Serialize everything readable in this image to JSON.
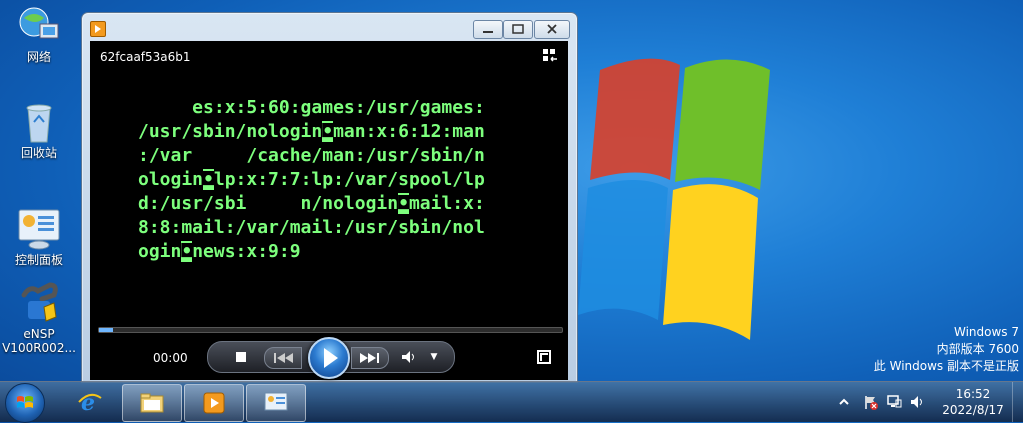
{
  "desktop": {
    "icons": [
      {
        "label": "网络",
        "icon": "network-icon"
      },
      {
        "label": "回收站",
        "icon": "recycle-bin-icon"
      },
      {
        "label": "控制面板",
        "icon": "control-panel-icon"
      },
      {
        "label_line1": "eNSP",
        "label_line2": "V100R002...",
        "icon": "ensp-icon"
      }
    ],
    "watermark": {
      "line1": "Windows 7",
      "line2": "内部版本 7600",
      "line3": "此 Windows 副本不是正版"
    }
  },
  "player": {
    "video_title": "62fcaaf53a6b1",
    "terminal_lines": [
      "     es:x:5:60:games:/usr/games:",
      "/usr/sbin/nologin",
      "man:x:6:12:man",
      ":/var     /cache/man:/usr/sbin/n",
      "ologin",
      "lp:x:7:7:lp:/var/spool/lp",
      "d:/usr/sbi     n/nologin",
      "mail:x:",
      "8:8:mail:/var/mail:/usr/sbin/nol",
      "ogin",
      "news:x:9:9"
    ],
    "time": "00:00",
    "progress": 0.03,
    "colors": {
      "terminal_text": "#7dff7d",
      "progress_fill": "#6fb6ff"
    }
  },
  "taskbar": {
    "clock_time": "16:52",
    "clock_date": "2022/8/17"
  }
}
